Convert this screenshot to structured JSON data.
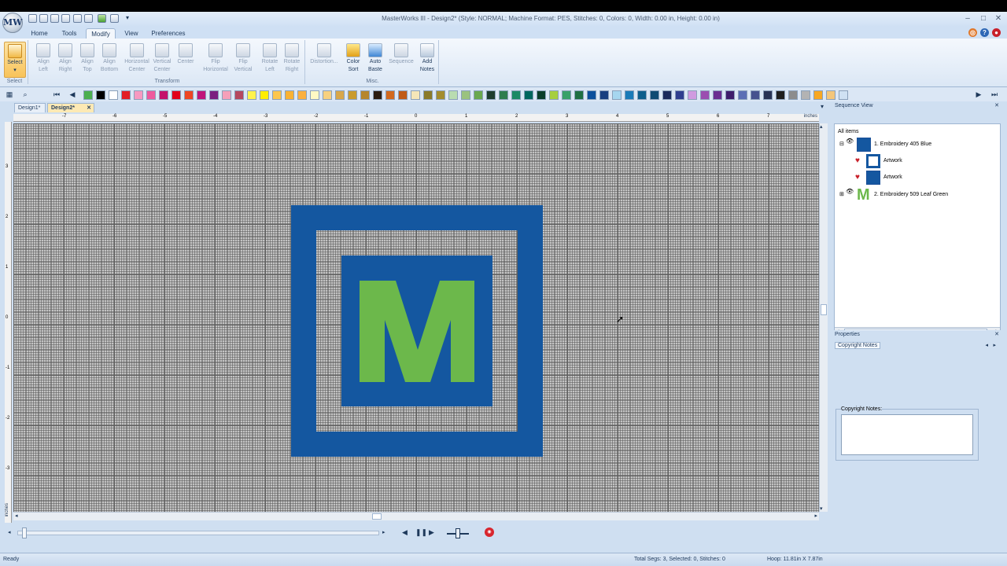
{
  "window": {
    "title": "MasterWorks III - Design2* (Style: NORMAL; Machine Format: PES, Stitches: 0, Colors: 0, Width: 0.00 in, Height: 0.00 in)",
    "logo_text": "MW"
  },
  "tabs": [
    "Home",
    "Tools",
    "Modify",
    "View",
    "Preferences"
  ],
  "ribbon": {
    "select_group": "Select",
    "select_button": "Select",
    "transform_group": "Transform",
    "transform_buttons": [
      {
        "l1": "Align",
        "l2": "Left"
      },
      {
        "l1": "Align",
        "l2": "Right"
      },
      {
        "l1": "Align",
        "l2": "Top"
      },
      {
        "l1": "Align",
        "l2": "Bottom"
      },
      {
        "l1": "Horizontal",
        "l2": "Center"
      },
      {
        "l1": "Vertical",
        "l2": "Center"
      },
      {
        "l1": "Center",
        "l2": ""
      },
      {
        "l1": "Flip",
        "l2": "Horizontal"
      },
      {
        "l1": "Flip",
        "l2": "Vertical"
      },
      {
        "l1": "Rotate",
        "l2": "Left"
      },
      {
        "l1": "Rotate",
        "l2": "Right"
      }
    ],
    "misc_group": "Misc.",
    "misc_buttons": [
      {
        "l1": "Distortion...",
        "l2": ""
      },
      {
        "l1": "Color",
        "l2": "Sort"
      },
      {
        "l1": "Auto",
        "l2": "Baste"
      },
      {
        "l1": "Sequence",
        "l2": ""
      },
      {
        "l1": "Add",
        "l2": "Notes"
      }
    ]
  },
  "palette": [
    "#4caf50",
    "#000000",
    "#ffffff",
    "#e31e24",
    "#f799c0",
    "#ee5a9d",
    "#c4126b",
    "#e2001a",
    "#ee4623",
    "#c0157a",
    "#7b1e80",
    "#f5a0b9",
    "#b5485f",
    "#fff34d",
    "#ffed00",
    "#fcc64d",
    "#f9b233",
    "#fbb040",
    "#fff9c4",
    "#f7d180",
    "#d8a74a",
    "#c99b2d",
    "#b6862c",
    "#2b1d12",
    "#d2691e",
    "#c05a16",
    "#f5e6b8",
    "#8a7a2a",
    "#a38c2e",
    "#b9dcb0",
    "#9ac27f",
    "#6aa84f",
    "#1e3d2f",
    "#2e7d4f",
    "#1b8a66",
    "#00665e",
    "#0a3d2a",
    "#a6cf3e",
    "#38a169",
    "#1f6f43",
    "#0b4f9c",
    "#173f80",
    "#a6d6ef",
    "#1a7ab8",
    "#0e5e8c",
    "#0f4a73",
    "#1a2a5c",
    "#2f3f8f",
    "#d09be0",
    "#9b4fb0",
    "#6a2e91",
    "#3d1d6b",
    "#5b6fb5",
    "#46538f",
    "#283355",
    "#1f1f1f",
    "#8c8c8c",
    "#b3b3b3",
    "#f7a823",
    "#f4c67a",
    "#cfe1f3"
  ],
  "doc_tabs": [
    "Design1*",
    "Design2*"
  ],
  "ruler": {
    "unit": "inches",
    "h_labels": [
      "-7",
      "-6",
      "-5",
      "-4",
      "-3",
      "-2",
      "-1",
      "0",
      "1",
      "2",
      "3",
      "4",
      "5",
      "6",
      "7"
    ],
    "v_labels": [
      "3",
      "2",
      "1",
      "0",
      "-1",
      "-2",
      "-3"
    ]
  },
  "design": {
    "letter": "M",
    "outer_color": "#1457a0",
    "inner_color": "#1457a0",
    "letter_color": "#6cb84b"
  },
  "sequence": {
    "title": "Sequence View",
    "root": "All items",
    "items": [
      {
        "label": "1. Embroidery 405 Blue",
        "color": "#1457a0"
      },
      {
        "label": "Artwork",
        "color": "#ffffff"
      },
      {
        "label": "Artwork",
        "color": "#1457a0"
      },
      {
        "label": "2. Embroidery 509 Leaf Green",
        "color": "#6cb84b"
      }
    ]
  },
  "properties": {
    "title": "Properties",
    "tab": "Copyright Notes",
    "field_label": "Copyright Notes:",
    "field_value": ""
  },
  "status": {
    "ready": "Ready",
    "totals": "Total Segs: 3, Selected: 0, Stitches: 0",
    "hoop": "Hoop: 11.81in X 7.87in"
  },
  "colors": {
    "accent": "#f8c35a",
    "ribbon_bg": "#dbe7f5"
  }
}
